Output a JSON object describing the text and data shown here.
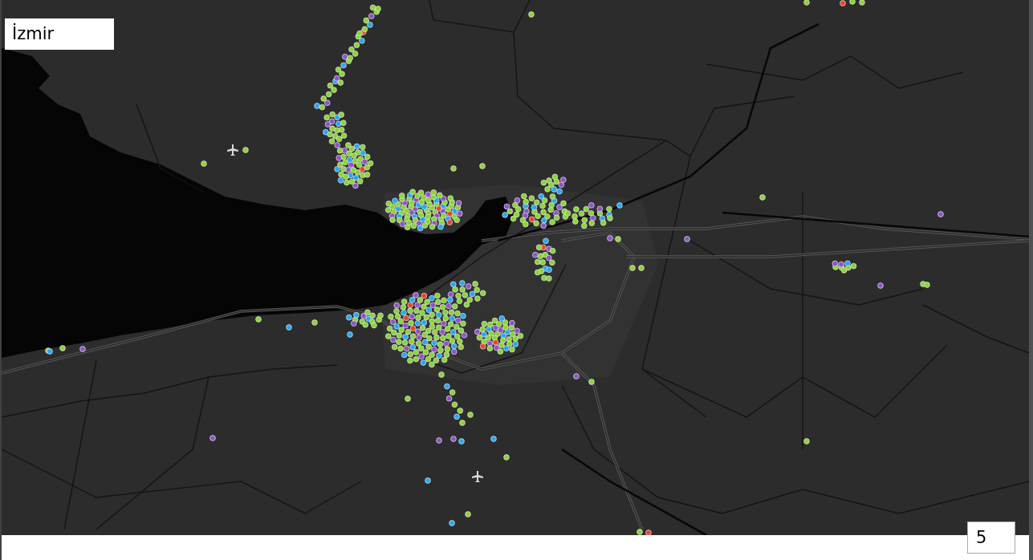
{
  "title": "İzmir",
  "page_number": "5"
}
